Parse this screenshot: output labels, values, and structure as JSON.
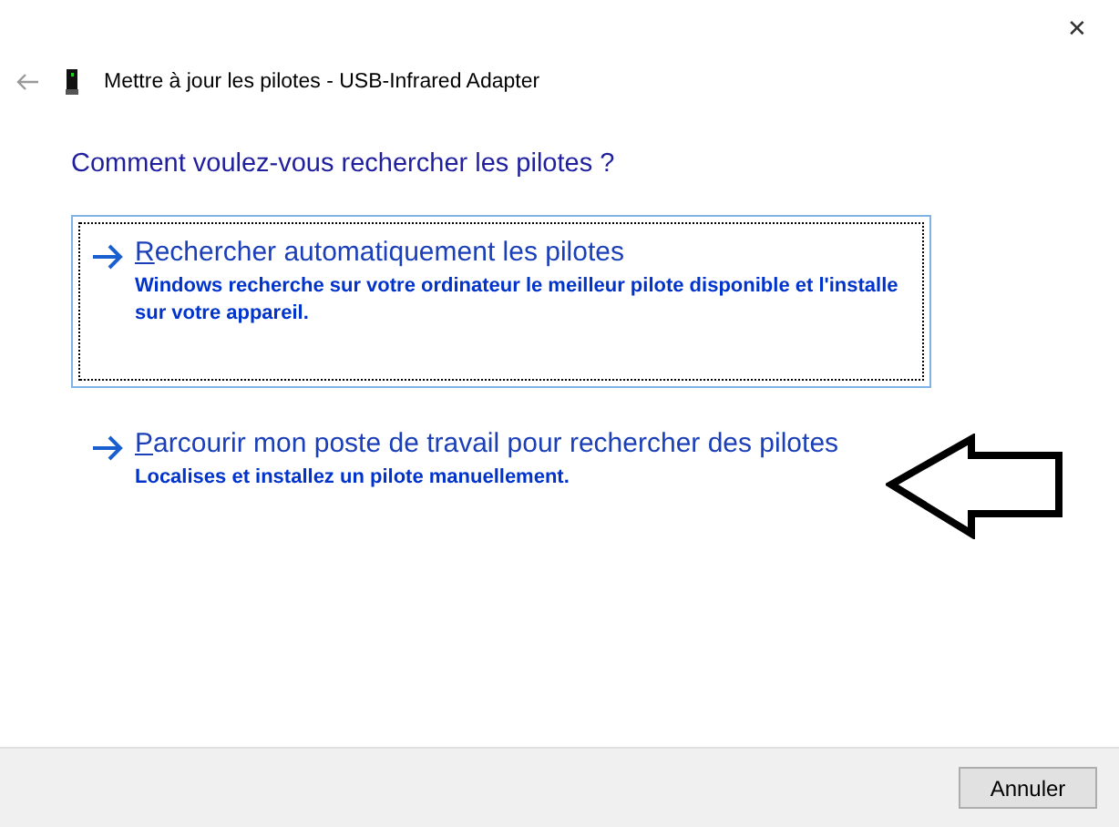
{
  "window": {
    "close": "✕",
    "title": "Mettre à jour les pilotes - USB-Infrared Adapter"
  },
  "heading": "Comment voulez-vous rechercher les pilotes ?",
  "options": [
    {
      "title": "Rechercher automatiquement les pilotes",
      "description": "Windows recherche sur votre ordinateur le meilleur pilote disponible et l'installe sur votre appareil.",
      "selected": true
    },
    {
      "title": "Parcourir mon poste de travail pour rechercher des pilotes",
      "description": "Localises et installez un pilote manuellement.",
      "selected": false
    }
  ],
  "buttons": [
    "Annuler"
  ]
}
